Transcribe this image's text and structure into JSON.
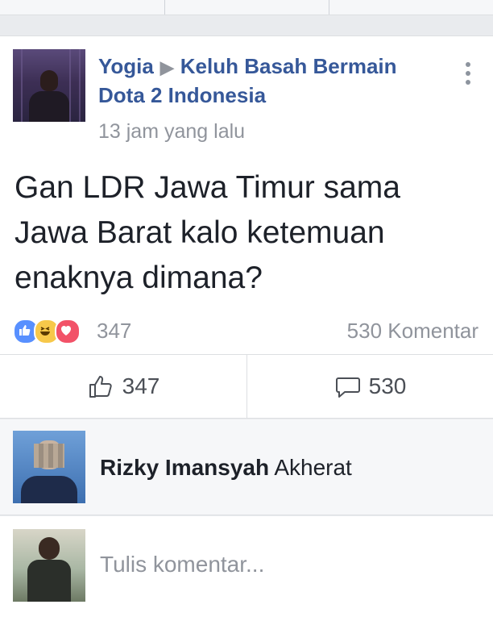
{
  "post": {
    "author": "Yogia",
    "group_line1": "Keluh Basah Bermain",
    "group_line2": "Dota 2 Indonesia",
    "timestamp": "13 jam yang lalu",
    "text": "Gan LDR Jawa Timur sama Jawa Barat kalo ketemuan enaknya dimana?",
    "reaction_count": "347",
    "comment_count_label": "530 Komentar"
  },
  "actions": {
    "like_count": "347",
    "comment_count": "530"
  },
  "comment": {
    "author": "Rizky Imansyah",
    "text": "Akherat"
  },
  "composer": {
    "placeholder": "Tulis komentar..."
  },
  "icons": {
    "reactions": [
      "like-icon",
      "haha-icon",
      "love-icon"
    ],
    "like": "thumbs-up-icon",
    "comment": "speech-bubble-icon",
    "more": "more-vertical-icon"
  },
  "colors": {
    "link": "#365899",
    "meta": "#90949c",
    "like": "#5890ff",
    "haha": "#f7c84a",
    "love": "#f25268"
  }
}
